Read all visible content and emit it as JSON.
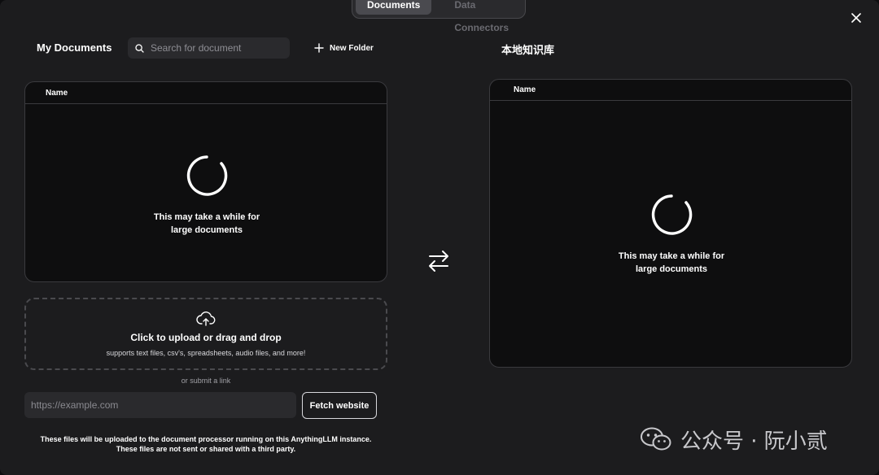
{
  "tabs": [
    {
      "label": "Documents",
      "active": true
    },
    {
      "label": "Data Connectors",
      "active": false
    }
  ],
  "left": {
    "title": "My Documents",
    "search_placeholder": "Search for document",
    "new_folder_label": "New Folder",
    "column_name": "Name",
    "loading_line1": "This may take a while for",
    "loading_line2": "large documents"
  },
  "right": {
    "title": "本地知识库",
    "column_name": "Name",
    "loading_line1": "This may take a while for",
    "loading_line2": "large documents"
  },
  "upload": {
    "title": "Click to upload or drag and drop",
    "subtitle": "supports text files, csv's, spreadsheets, audio files, and more!",
    "or_link": "or submit a link",
    "url_placeholder": "https://example.com",
    "fetch_label": "Fetch website"
  },
  "notice": {
    "line1": "These files will be uploaded to the document processor running on this AnythingLLM instance.",
    "line2": "These files are not sent or shared with a third party."
  },
  "watermark": {
    "text": "公众号 · 阮小贰"
  },
  "icons": {
    "close": "close-icon",
    "search": "search-icon",
    "plus": "plus-icon",
    "spinner": "loading-spinner-icon",
    "swap": "swap-arrows-icon",
    "upload": "cloud-upload-icon",
    "wechat": "wechat-icon"
  },
  "colors": {
    "background": "#1c1c1e",
    "panel": "#0e0e0f",
    "border": "#3a3a3e",
    "input": "#2a2a2d",
    "text": "#ffffff"
  }
}
